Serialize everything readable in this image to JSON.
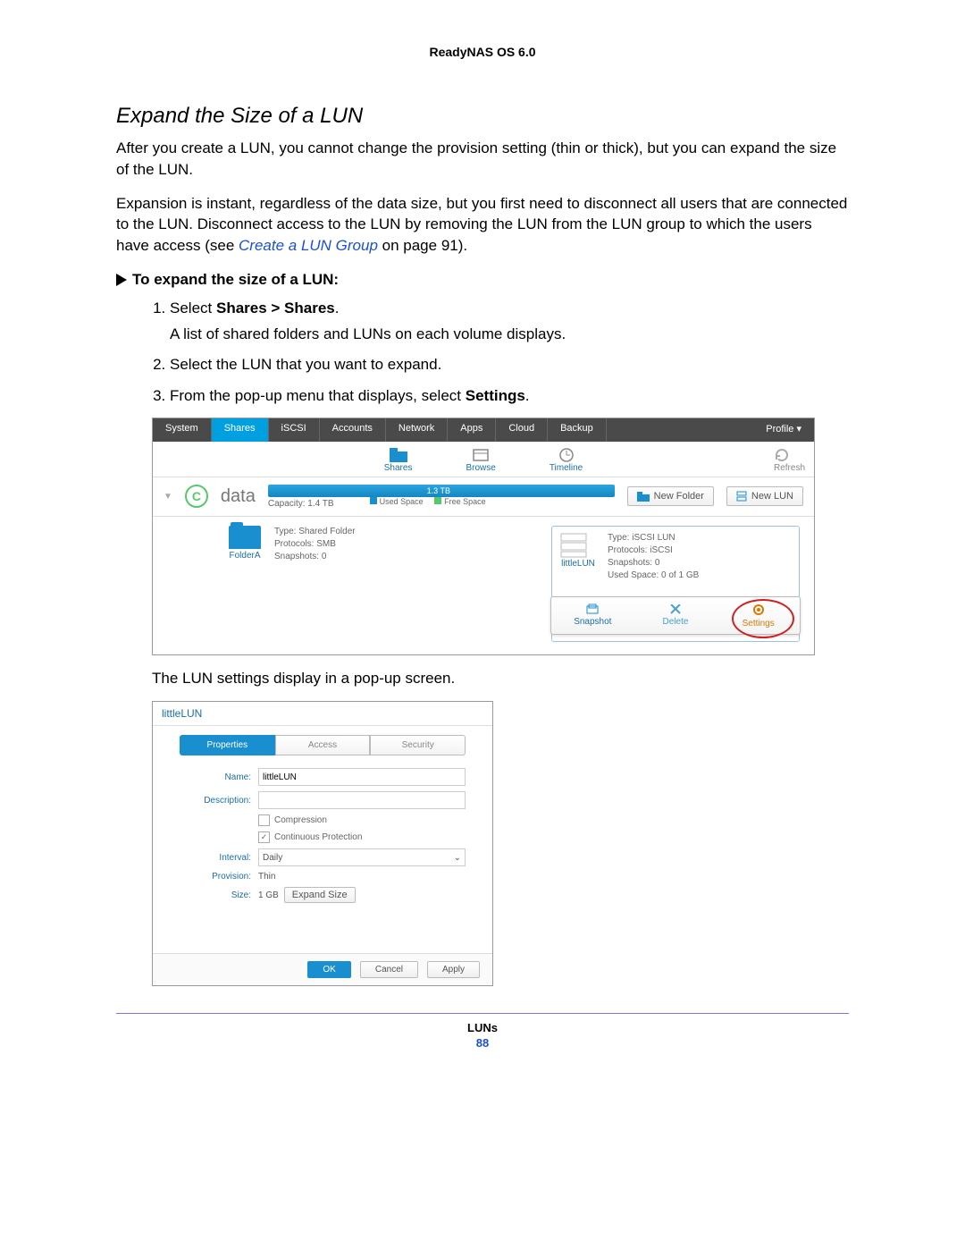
{
  "doc_header": "ReadyNAS OS 6.0",
  "section_title": "Expand the Size of a LUN",
  "para1": "After you create a LUN, you cannot change the provision setting (thin or thick), but you can expand the size of the LUN.",
  "para2_a": "Expansion is instant, regardless of the data size, but you first need to disconnect all users that are connected to the LUN. Disconnect access to the LUN by removing the LUN from the LUN group to which the users have access (see ",
  "para2_link": "Create a LUN Group",
  "para2_b": " on page 91).",
  "proc_head": "To expand the size of a LUN:",
  "steps": {
    "s1_a": "Select ",
    "s1_b": "Shares > Shares",
    "s1_sub": "A list of shared folders and LUNs on each volume displays.",
    "s2": "Select the LUN that you want to expand.",
    "s3_a": "From the pop-up menu that displays, select ",
    "s3_b": "Settings"
  },
  "fig1": {
    "nav": [
      "System",
      "Shares",
      "iSCSI",
      "Accounts",
      "Network",
      "Apps",
      "Cloud",
      "Backup"
    ],
    "nav_active": "Shares",
    "profile": "Profile ▾",
    "subnav": {
      "shares": "Shares",
      "browse": "Browse",
      "timeline": "Timeline",
      "refresh": "Refresh"
    },
    "volume": {
      "name": "data",
      "bar_text": "1.3 TB",
      "capacity": "Capacity: 1.4 TB",
      "used": "Used Space",
      "free": "Free Space"
    },
    "btn_newfolder": "New Folder",
    "btn_newlun": "New LUN",
    "folder": {
      "name": "FolderA",
      "type": "Type: Shared Folder",
      "protocols": "Protocols: SMB",
      "snapshots": "Snapshots: 0"
    },
    "lun": {
      "name": "littleLUN",
      "type": "Type: iSCSI LUN",
      "protocols": "Protocols: iSCSI",
      "snapshots": "Snapshots: 0",
      "used": "Used Space: 0 of 1 GB"
    },
    "popup": {
      "snapshot": "Snapshot",
      "delete": "Delete",
      "settings": "Settings"
    }
  },
  "after_fig1": "The LUN settings display in a pop-up screen.",
  "fig2": {
    "title": "littleLUN",
    "tabs": [
      "Properties",
      "Access",
      "Security"
    ],
    "tabs_active": "Properties",
    "labels": {
      "name": "Name:",
      "name_val": "littleLUN",
      "desc": "Description:",
      "compression": "Compression",
      "contprot": "Continuous Protection",
      "interval": "Interval:",
      "interval_val": "Daily",
      "provision": "Provision:",
      "provision_val": "Thin",
      "size": "Size:",
      "size_val": "1 GB",
      "expand": "Expand Size"
    },
    "buttons": {
      "ok": "OK",
      "cancel": "Cancel",
      "apply": "Apply"
    }
  },
  "footer": {
    "section": "LUNs",
    "page": "88"
  }
}
